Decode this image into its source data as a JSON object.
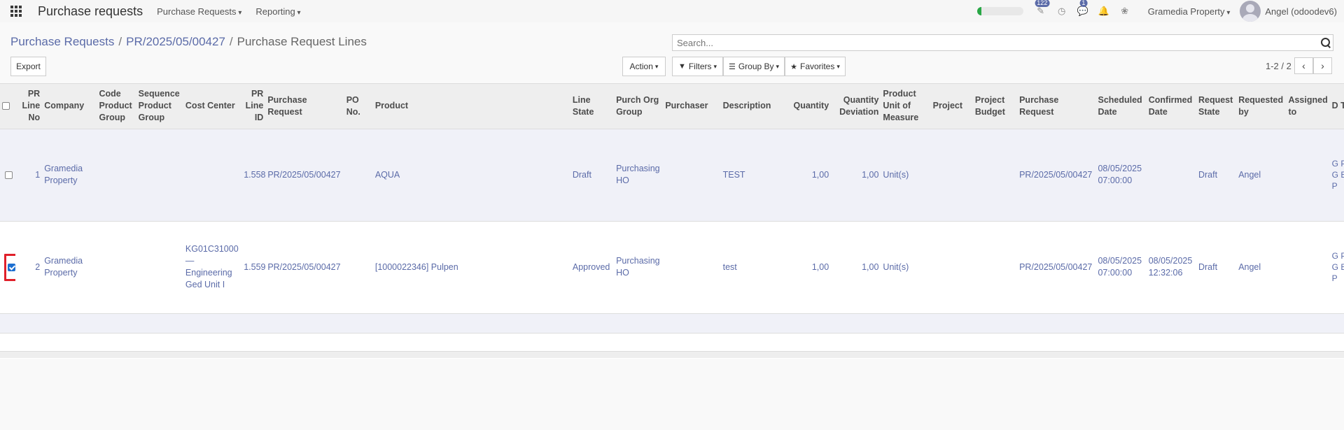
{
  "navbar": {
    "app_title": "Purchase requests",
    "menus": [
      "Purchase Requests",
      "Reporting"
    ],
    "progress_fraction": 0.1,
    "activity_badge": "122",
    "messages_badge": "1",
    "company": "Gramedia Property",
    "user": "Angel (odoodev6)",
    "icons": [
      "apps-grid-icon",
      "edit-activity-icon",
      "clock-icon",
      "chat-icon",
      "bell-icon",
      "bug-icon"
    ]
  },
  "breadcrumb": {
    "items": [
      "Purchase Requests",
      "PR/2025/05/00427"
    ],
    "current": "Purchase Request Lines",
    "separator": "/"
  },
  "search": {
    "placeholder": "Search..."
  },
  "toolbar": {
    "export": "Export",
    "action": "Action",
    "filters": "Filters",
    "group_by": "Group By",
    "favorites": "Favorites",
    "pager": "1-2 / 2"
  },
  "table": {
    "headers": {
      "pr_line_no": "PR Line No",
      "company": "Company",
      "code_product_group": "Code Product Group",
      "sequence_product_group": "Sequence Product Group",
      "cost_center": "Cost Center",
      "pr_line_id": "PR Line ID",
      "purchase_request": "Purchase Request",
      "po_no": "PO No.",
      "product": "Product",
      "line_state": "Line State",
      "purch_org_group": "Purch Org Group",
      "purchaser": "Purchaser",
      "description": "Description",
      "quantity": "Quantity",
      "quantity_deviation": "Quantity Deviation",
      "product_uom": "Product Unit of Measure",
      "project": "Project",
      "project_budget": "Project Budget",
      "purchase_request_2": "Purchase Request",
      "scheduled_date": "Scheduled Date",
      "confirmed_date": "Confirmed Date",
      "request_state": "Request State",
      "requested_by": "Requested by",
      "assigned_to": "Assigned to",
      "cut_col": "D T"
    },
    "rows": [
      {
        "checked": false,
        "pr_line_no": "1",
        "company": "Gramedia Property",
        "code_product_group": "",
        "sequence_product_group": "",
        "cost_center": "",
        "pr_line_id": "1.558",
        "purchase_request": "PR/2025/05/00427",
        "po_no": "",
        "product": "AQUA",
        "line_state": "Draft",
        "purch_org_group": "Purchasing HO",
        "purchaser": "",
        "description": "TEST",
        "quantity": "1,00",
        "quantity_deviation": "1,00",
        "product_uom": "Unit(s)",
        "project": "",
        "project_budget": "",
        "purchase_request_2": "PR/2025/05/00427",
        "scheduled_date": "08/05/2025 07:00:00",
        "confirmed_date": "",
        "request_state": "Draft",
        "requested_by": "Angel",
        "assigned_to": "",
        "cut_col": "G P ( G E R P"
      },
      {
        "checked": true,
        "pr_line_no": "2",
        "company": "Gramedia Property",
        "code_product_group": "",
        "sequence_product_group": "",
        "cost_center": "KG01C31000 — Engineering Ged Unit I",
        "pr_line_id": "1.559",
        "purchase_request": "PR/2025/05/00427",
        "po_no": "",
        "product": "[1000022346] Pulpen",
        "line_state": "Approved",
        "purch_org_group": "Purchasing HO",
        "purchaser": "",
        "description": "test",
        "quantity": "1,00",
        "quantity_deviation": "1,00",
        "product_uom": "Unit(s)",
        "project": "",
        "project_budget": "",
        "purchase_request_2": "PR/2025/05/00427",
        "scheduled_date": "08/05/2025 07:00:00",
        "confirmed_date": "08/05/2025 12:32:06",
        "request_state": "Draft",
        "requested_by": "Angel",
        "assigned_to": "",
        "cut_col": "G P ( G E R P"
      }
    ]
  }
}
